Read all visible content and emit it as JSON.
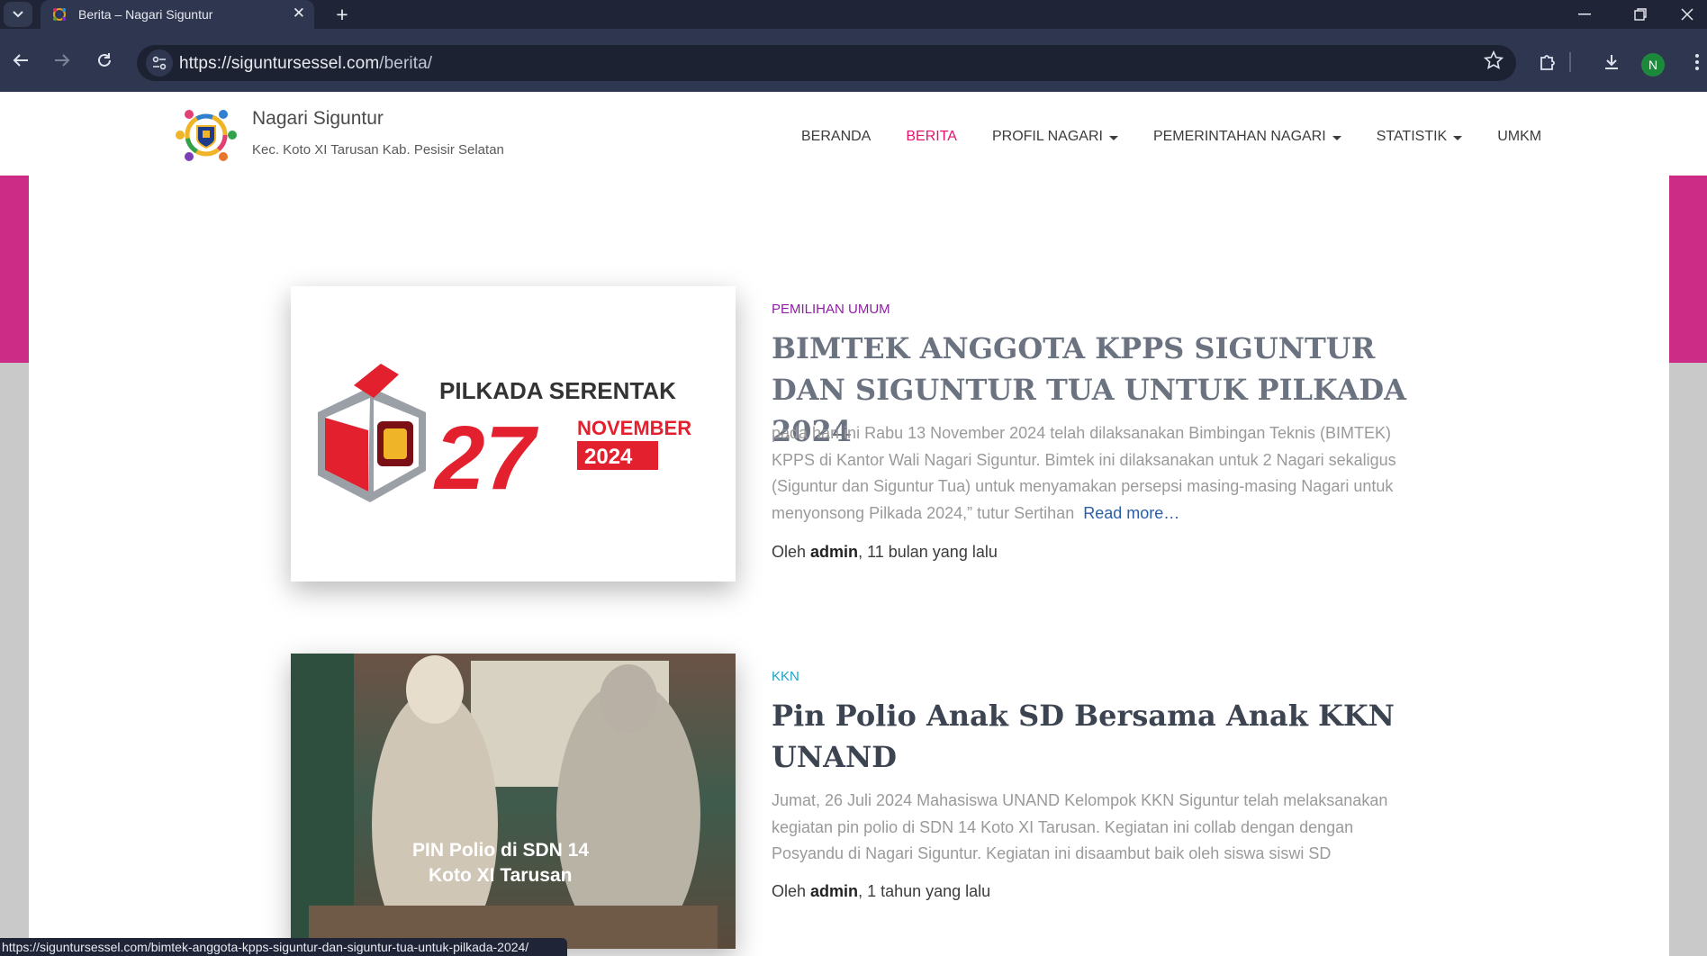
{
  "browser": {
    "tab_title": "Berita – Nagari Siguntur",
    "tab_close": "✕",
    "new_tab": "+",
    "url_host": "https://siguntursessel.com",
    "url_path": "/berita/",
    "profile_initial": "N",
    "status_url": "https://siguntursessel.com/bimtek-anggota-kpps-siguntur-dan-siguntur-tua-untuk-pilkada-2024/"
  },
  "site": {
    "name": "Nagari Siguntur",
    "tagline": "Kec. Koto XI Tarusan Kab. Pesisir Selatan"
  },
  "nav": {
    "items": [
      "BERANDA",
      "BERITA",
      "PROFIL NAGARI",
      "PEMERINTAHAN NAGARI",
      "STATISTIK",
      "UMKM"
    ],
    "active": "BERITA"
  },
  "posts": [
    {
      "category": "PEMILIHAN UMUM",
      "category_color": "#8e1fa3",
      "title": "BIMTEK ANGGOTA KPPS SIGUNTUR DAN SIGUNTUR TUA UNTUK PILKADA 2024",
      "title_color": "#6b7280",
      "excerpt": "pada hari ini Rabu 13 November 2024 telah dilaksanakan Bimbingan Teknis (BIMTEK) KPPS di Kantor Wali Nagari Siguntur. Bimtek ini dilaksanakan untuk 2 Nagari sekaligus (Siguntur dan Siguntur Tua) untuk menyamakan persepsi masing-masing Nagari untuk menyonsong Pilkada 2024,” tutur Sertihan",
      "read_more": "Read more…",
      "meta_prefix": "Oleh",
      "author": "admin",
      "meta_suffix": ", 11 bulan yang lalu",
      "thumb": {
        "headline": "PILKADA SERENTAK",
        "day": "27",
        "month": "NOVEMBER",
        "year": "2024"
      }
    },
    {
      "category": "KKN",
      "category_color": "#1aa5c9",
      "title": "Pin Polio Anak SD Bersama Anak KKN UNAND",
      "title_color": "#3d4451",
      "excerpt": "Jumat, 26 Juli 2024 Mahasiswa UNAND Kelompok KKN Siguntur telah melaksanakan kegiatan pin polio di SDN 14 Koto XI Tarusan. Kegiatan ini collab dengan dengan Posyandu di Nagari Siguntur. Kegiatan ini disaambut baik oleh siswa siswi SD",
      "read_more": "",
      "meta_prefix": "Oleh",
      "author": "admin",
      "meta_suffix": ", 1 tahun yang lalu",
      "thumb": {
        "caption_line1": "PIN Polio di SDN 14",
        "caption_line2": "Koto XI Tarusan"
      }
    }
  ]
}
